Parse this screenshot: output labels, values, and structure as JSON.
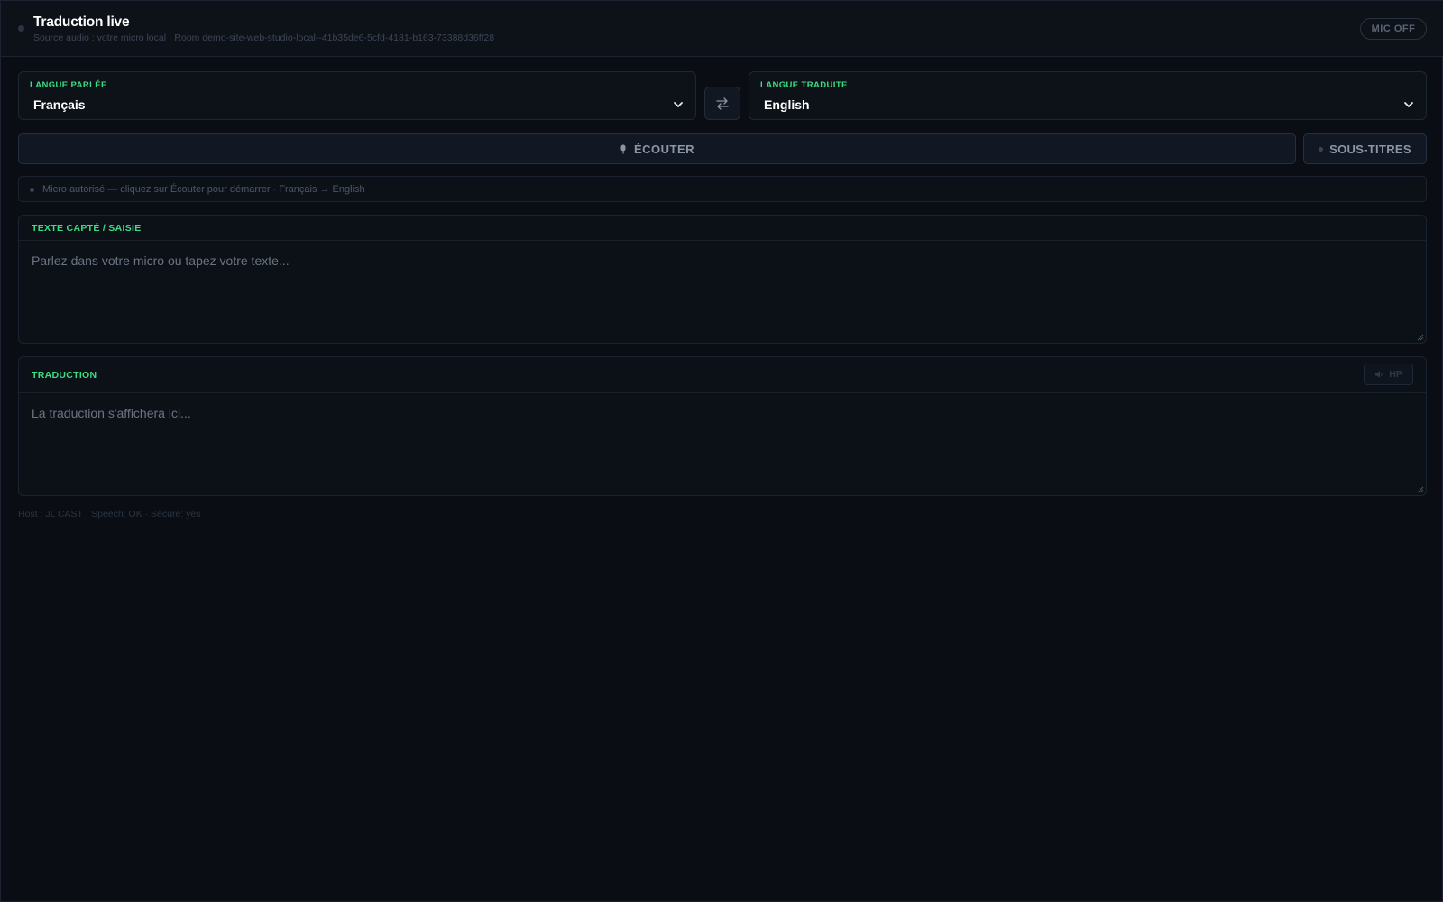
{
  "header": {
    "title": "Traduction live",
    "subtitle": "Source audio : votre micro local · Room demo-site-web-studio-local--41b35de6-5cfd-4181-b163-73388d36ff28",
    "mic_status": "MIC OFF"
  },
  "languages": {
    "source": {
      "label": "LANGUE PARLÉE",
      "value": "Français"
    },
    "target": {
      "label": "LANGUE TRADUITE",
      "value": "English"
    },
    "swap_icon": "swap-arrows-icon"
  },
  "actions": {
    "listen_label": "ÉCOUTER",
    "listen_icon": "microphone-icon",
    "subtitles_label": "SOUS-TITRES"
  },
  "status": {
    "text": "Micro autorisé — cliquez sur Écouter pour démarrer · Français → English"
  },
  "captured": {
    "title": "TEXTE CAPTÉ / SAISIE",
    "placeholder": "Parlez dans votre micro ou tapez votre texte..."
  },
  "translation": {
    "title": "TRADUCTION",
    "placeholder": "La traduction s'affichera ici...",
    "hp_label": "HP",
    "hp_icon": "speaker-icon"
  },
  "footer": {
    "text": "Host : JL CAST · Speech: OK · Secure: yes"
  },
  "colors": {
    "background": "#0a0e14",
    "accent": "#3ddc84",
    "panel": "#0c1118",
    "border": "#1b2330"
  }
}
